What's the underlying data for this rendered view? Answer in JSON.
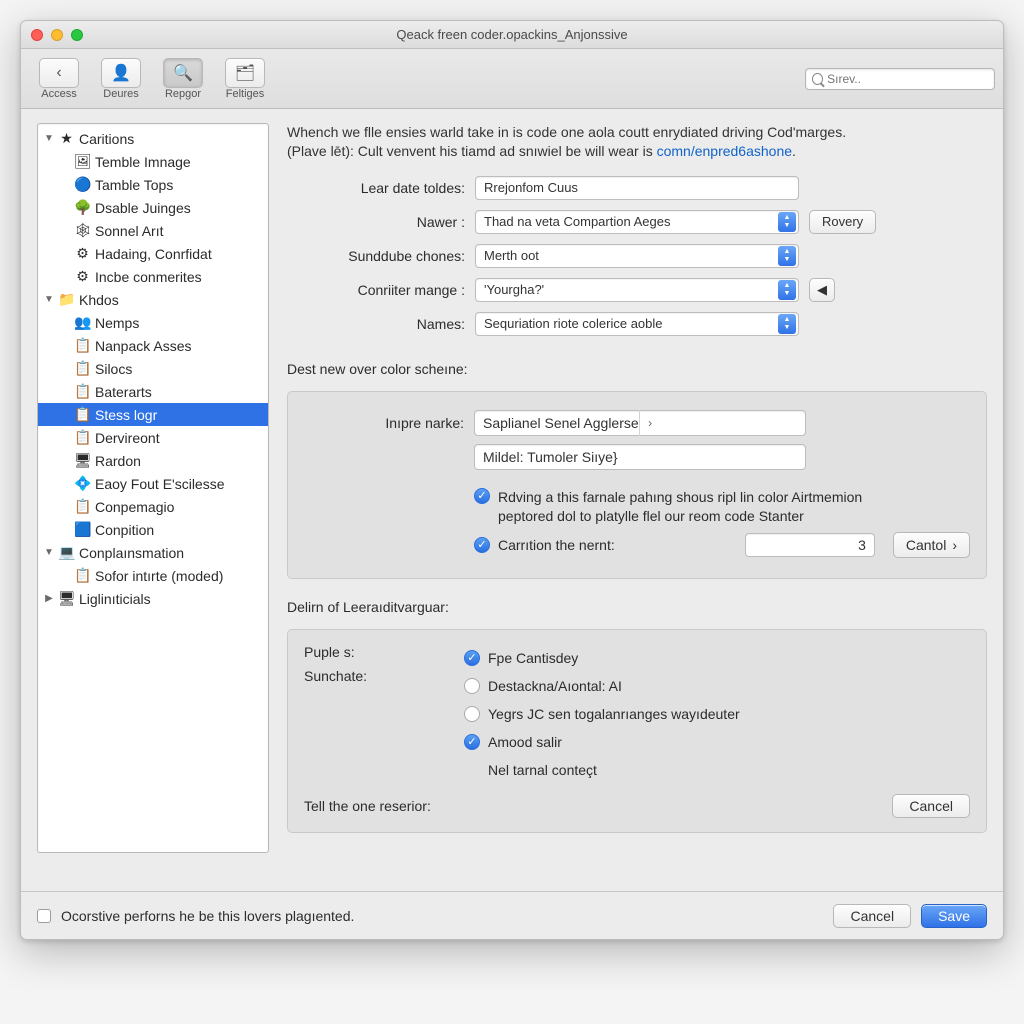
{
  "window": {
    "title": "Qeack freen coder.opackins_Anjonssive"
  },
  "toolbar": {
    "items": [
      {
        "label": "Access",
        "glyph": "‹"
      },
      {
        "label": "Deures",
        "glyph": "👤"
      },
      {
        "label": "Repgor",
        "glyph": "🔍"
      },
      {
        "label": "Feltiges",
        "glyph": "🗂"
      }
    ],
    "search_placeholder": "Sırev.."
  },
  "sidebar": [
    {
      "label": "Caritions",
      "icon": "★",
      "disclosure": "open"
    },
    {
      "label": "Temble Imnage",
      "icon": "🖼",
      "indent": 1
    },
    {
      "label": "Tamble Tops",
      "icon": "🔵",
      "indent": 1
    },
    {
      "label": "Dsable Juinges",
      "icon": "🌳",
      "indent": 1
    },
    {
      "label": "Sonnel Arıt",
      "icon": "🕸",
      "indent": 1
    },
    {
      "label": "Hadaing, Conrfidat",
      "icon": "⚙",
      "indent": 1
    },
    {
      "label": "Incbe conmerites",
      "icon": "⚙",
      "indent": 1
    },
    {
      "label": "Khdos",
      "icon": "📁",
      "disclosure": "open"
    },
    {
      "label": "Nemps",
      "icon": "👥",
      "indent": 1
    },
    {
      "label": "Nanpack Asses",
      "icon": "📋",
      "indent": 1
    },
    {
      "label": "Silocs",
      "icon": "📋",
      "indent": 1
    },
    {
      "label": "Baterarts",
      "icon": "📋",
      "indent": 1
    },
    {
      "label": "Stess logr",
      "icon": "📋",
      "indent": 1,
      "selected": true
    },
    {
      "label": "Dervireont",
      "icon": "📋",
      "indent": 1
    },
    {
      "label": "Rardon",
      "icon": "🖥",
      "indent": 1
    },
    {
      "label": "Eaoy Fout E'scilesse",
      "icon": "💠",
      "indent": 1
    },
    {
      "label": "Conpemagio",
      "icon": "📋",
      "indent": 1
    },
    {
      "label": "Conpition",
      "icon": "🟦",
      "indent": 1
    },
    {
      "label": "Conplaınsmation",
      "icon": "💻",
      "disclosure": "open"
    },
    {
      "label": "Sofor intırte (moded)",
      "icon": "📋",
      "indent": 1
    },
    {
      "label": "Liglinıticials",
      "icon": "🖥",
      "disclosure": "closed"
    }
  ],
  "intro": {
    "line1": "Whench we flle ensies warld take in is code one aola coutt enrydiated driving Cod'marges.",
    "line2a": "(Plave lēt): Cult venvent his tiamd ad snıwiel be will wear is ",
    "link": "comn/enpred6ashone",
    "line2b": "."
  },
  "form": {
    "rows": [
      {
        "label": "Lear date toldes:",
        "type": "text",
        "value": "Rrejonfom Cuus"
      },
      {
        "label": "Nawer :",
        "type": "popup",
        "value": "Thad na veta Compartion Aeges",
        "side_button": "Rovery"
      },
      {
        "label": "Sunddube chones:",
        "type": "popup",
        "value": "Merth oot"
      },
      {
        "label": "Conriiter mange :",
        "type": "popup",
        "value": "'Yourgha?'",
        "side_square": "◀"
      },
      {
        "label": "Names:",
        "type": "popup",
        "value": "Sequriation riote colerice aoble"
      }
    ]
  },
  "section_best": {
    "title": "Dest new over color scheıne:",
    "inner_label": "Inıpre narke:",
    "picker_value": "Saplianel Senel Agglerse",
    "mid_field": "Mildel: Tumoler Siıye}",
    "check_long": "Rdving a this farnale pahıng shous ripl lin color Airtmemion peptored dol to platylle flel our reom code Stanter",
    "check_short": "Carrıtion the nernt:",
    "num_value": "3",
    "cantol_btn": "Cantol",
    "cancel_small": "Cancel"
  },
  "section_lower": {
    "title": "Delirn of Leeraıditvarguar:",
    "left_labels": [
      "Puple s:",
      "Sunchate:"
    ],
    "opts": [
      {
        "text": "Fpe Cantisdey",
        "on": true
      },
      {
        "text": "Destackna/Aıontal:  AI",
        "on": false
      },
      {
        "text": "Yegrs JC sen togalanrıanges wayıdeuter",
        "on": false
      },
      {
        "text": "Amood salir",
        "on": true
      }
    ],
    "note": "Nel tarnal conteçt",
    "footer_label": "Tell the one reserior:"
  },
  "footer": {
    "checkbox_label": "Ocorstive perforns he be this lovers plagıented.",
    "cancel": "Cancel",
    "save": "Save"
  }
}
